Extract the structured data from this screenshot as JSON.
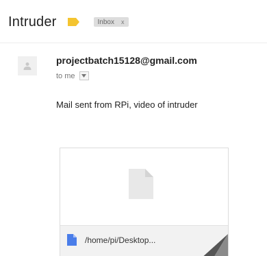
{
  "email": {
    "subject": "Intruder",
    "label": "Inbox",
    "label_remove": "x",
    "sender": "projectbatch15128@gmail.com",
    "recipient": "to me",
    "body": "Mail sent from RPi, video of intruder"
  },
  "attachment": {
    "file_name": "/home/pi/Desktop..."
  },
  "icons": {
    "importance": "importance-marker-icon",
    "avatar": "person-icon",
    "dropdown": "chevron-down-icon",
    "preview": "file-icon",
    "file_type": "document-icon"
  },
  "colors": {
    "importance": "#f4c430",
    "doc_icon": "#4a7de9",
    "label_chip": "#dddddd"
  }
}
